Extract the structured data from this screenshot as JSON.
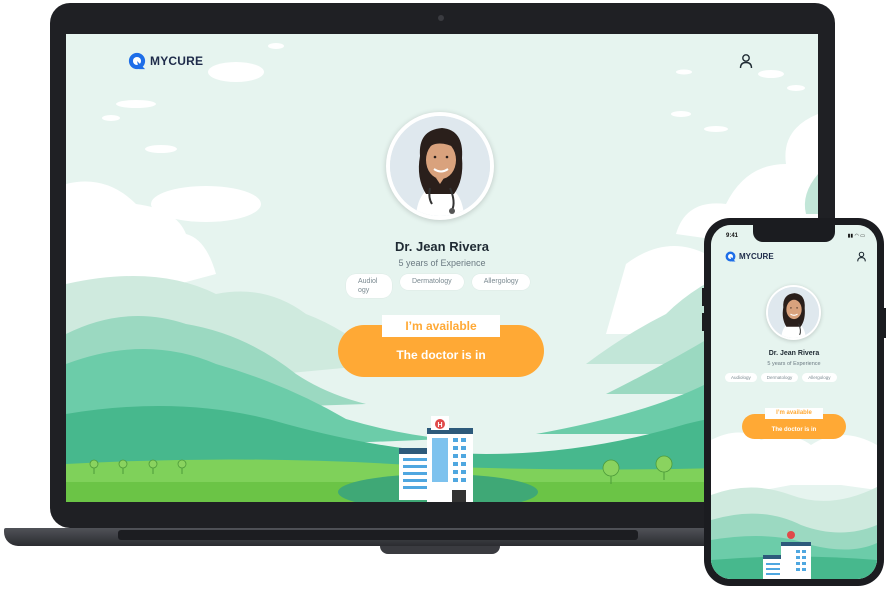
{
  "app": {
    "brand": "MYCURE"
  },
  "doctor": {
    "name": "Dr. Jean Rivera",
    "experience": "5 years of Experience",
    "specialties": [
      "Audiology",
      "Dermatology",
      "Allergology"
    ]
  },
  "status": {
    "label": "I’m available",
    "message": "The doctor is in"
  },
  "phone": {
    "time": "9:41"
  },
  "colors": {
    "accent": "#ffa935",
    "brand": "#1e6ee8",
    "sky": "#e6f4ef",
    "hill": "#59c59f"
  }
}
